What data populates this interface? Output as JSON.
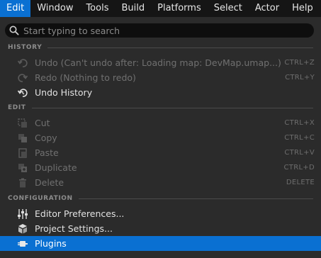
{
  "menubar": {
    "items": [
      "Edit",
      "Window",
      "Tools",
      "Build",
      "Platforms",
      "Select",
      "Actor",
      "Help"
    ]
  },
  "search": {
    "placeholder": "Start typing to search"
  },
  "sections": {
    "history": "HISTORY",
    "edit": "EDIT",
    "configuration": "CONFIGURATION"
  },
  "history": {
    "undo": {
      "label": "Undo (Can't undo after: Loading map: DevMap.umap...)",
      "shortcut": "CTRL+Z",
      "icon": "undo-icon"
    },
    "redo": {
      "label": "Redo (Nothing to redo)",
      "shortcut": "CTRL+Y",
      "icon": "redo-icon"
    },
    "undo_history": {
      "label": "Undo History",
      "icon": "undo-history-icon"
    }
  },
  "edit": {
    "cut": {
      "label": "Cut",
      "shortcut": "CTRL+X",
      "icon": "cut-icon"
    },
    "copy": {
      "label": "Copy",
      "shortcut": "CTRL+C",
      "icon": "copy-icon"
    },
    "paste": {
      "label": "Paste",
      "shortcut": "CTRL+V",
      "icon": "paste-icon"
    },
    "duplicate": {
      "label": "Duplicate",
      "shortcut": "CTRL+D",
      "icon": "duplicate-icon"
    },
    "delete": {
      "label": "Delete",
      "shortcut": "DELETE",
      "icon": "trash-icon"
    }
  },
  "configuration": {
    "editor_preferences": {
      "label": "Editor Preferences...",
      "icon": "sliders-icon"
    },
    "project_settings": {
      "label": "Project Settings...",
      "icon": "project-settings-icon"
    },
    "plugins": {
      "label": "Plugins",
      "icon": "plugin-icon"
    }
  },
  "colors": {
    "accent": "#0a70d2",
    "menu_bg": "#2b2b2b",
    "menubar_bg": "#151515"
  }
}
